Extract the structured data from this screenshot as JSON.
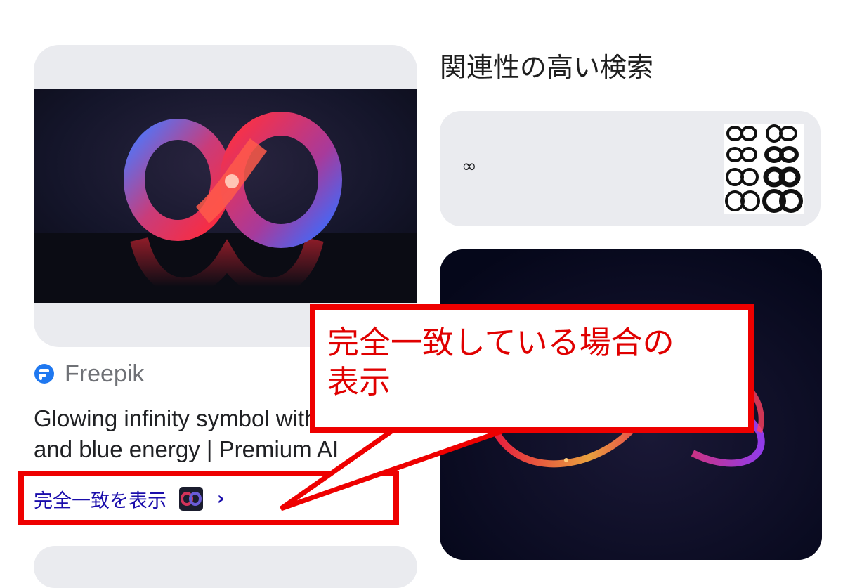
{
  "result": {
    "source_name": "Freepik",
    "source_icon": "freepik-logo-icon",
    "title_lines": [
      "Glowing infinity symbol with red",
      "and blue energy | Premium AI"
    ],
    "exact_match_label": "完全一致を表示",
    "exact_match_chevron": "›"
  },
  "related": {
    "heading": "関連性の高い検索",
    "chip_label": "∞"
  },
  "annotation": {
    "callout_lines": [
      "完全一致している場合の",
      "表示"
    ]
  },
  "colors": {
    "card_bg": "#eaebef",
    "link": "#1a0dab",
    "annotation_red": "#ee0000",
    "freepik_blue": "#1f78f0"
  }
}
